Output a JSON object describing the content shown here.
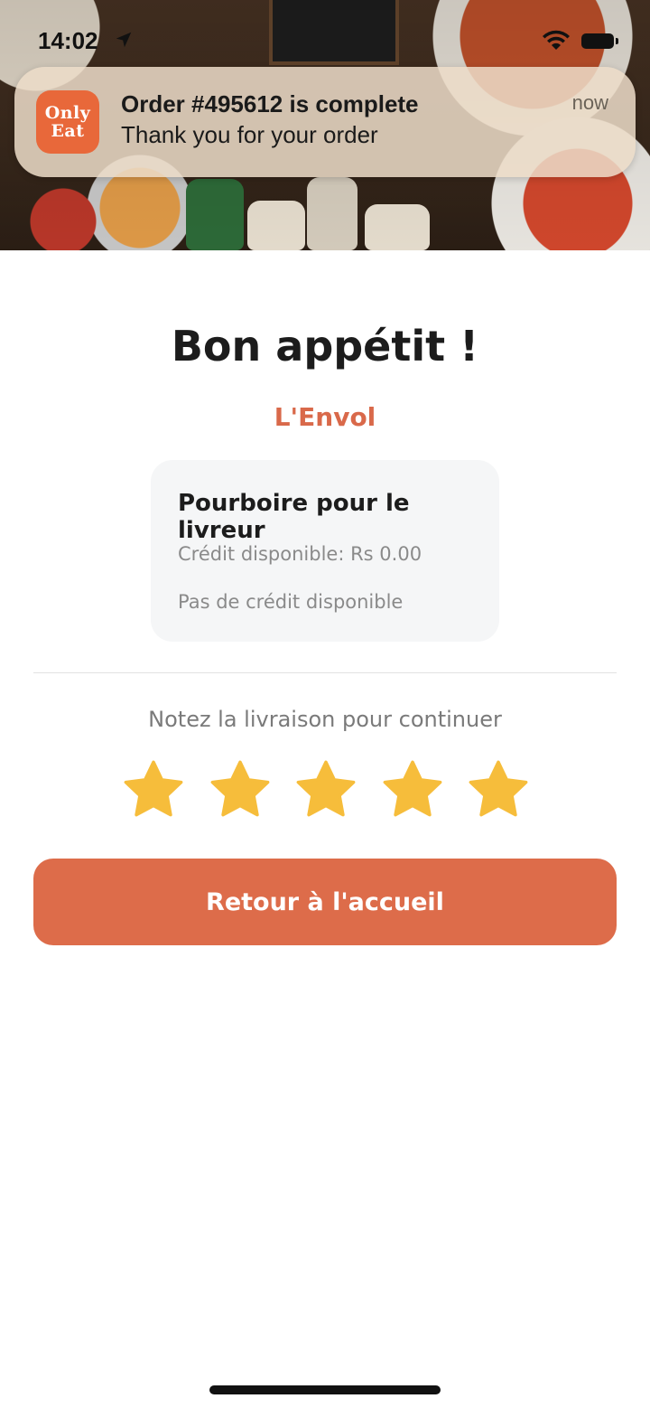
{
  "status_bar": {
    "time": "14:02"
  },
  "notification": {
    "app_icon_line1": "Only",
    "app_icon_line2": "Eat",
    "title": "Order #495612 is complete",
    "body": "Thank you for your order",
    "time": "now"
  },
  "main": {
    "title": "Bon appétit !",
    "restaurant": "L'Envol",
    "tip_card": {
      "title": "Pourboire pour le livreur",
      "credit": "Crédit disponible: Rs 0.00",
      "no_credit": "Pas de crédit disponible"
    },
    "rating": {
      "prompt": "Notez la livraison pour continuer",
      "max_stars": 5
    },
    "home_button": "Retour à l'accueil"
  },
  "colors": {
    "accent": "#dd6c4a",
    "restaurant_name": "#d9694a",
    "star": "#f6bd3b",
    "app_icon": "#e8683a"
  }
}
